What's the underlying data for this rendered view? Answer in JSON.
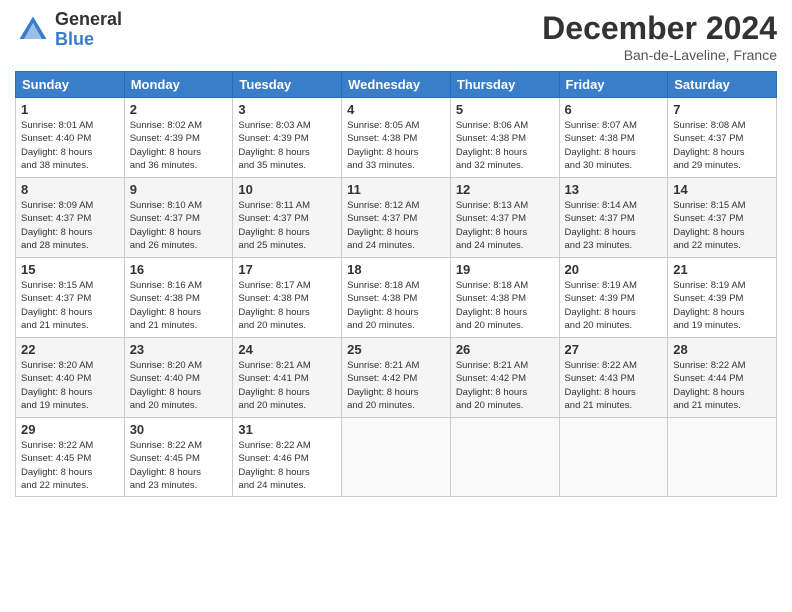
{
  "header": {
    "logo_general": "General",
    "logo_blue": "Blue",
    "month_title": "December 2024",
    "location": "Ban-de-Laveline, France"
  },
  "days_of_week": [
    "Sunday",
    "Monday",
    "Tuesday",
    "Wednesday",
    "Thursday",
    "Friday",
    "Saturday"
  ],
  "weeks": [
    [
      {
        "day": "1",
        "info": "Sunrise: 8:01 AM\nSunset: 4:40 PM\nDaylight: 8 hours\nand 38 minutes."
      },
      {
        "day": "2",
        "info": "Sunrise: 8:02 AM\nSunset: 4:39 PM\nDaylight: 8 hours\nand 36 minutes."
      },
      {
        "day": "3",
        "info": "Sunrise: 8:03 AM\nSunset: 4:39 PM\nDaylight: 8 hours\nand 35 minutes."
      },
      {
        "day": "4",
        "info": "Sunrise: 8:05 AM\nSunset: 4:38 PM\nDaylight: 8 hours\nand 33 minutes."
      },
      {
        "day": "5",
        "info": "Sunrise: 8:06 AM\nSunset: 4:38 PM\nDaylight: 8 hours\nand 32 minutes."
      },
      {
        "day": "6",
        "info": "Sunrise: 8:07 AM\nSunset: 4:38 PM\nDaylight: 8 hours\nand 30 minutes."
      },
      {
        "day": "7",
        "info": "Sunrise: 8:08 AM\nSunset: 4:37 PM\nDaylight: 8 hours\nand 29 minutes."
      }
    ],
    [
      {
        "day": "8",
        "info": "Sunrise: 8:09 AM\nSunset: 4:37 PM\nDaylight: 8 hours\nand 28 minutes."
      },
      {
        "day": "9",
        "info": "Sunrise: 8:10 AM\nSunset: 4:37 PM\nDaylight: 8 hours\nand 26 minutes."
      },
      {
        "day": "10",
        "info": "Sunrise: 8:11 AM\nSunset: 4:37 PM\nDaylight: 8 hours\nand 25 minutes."
      },
      {
        "day": "11",
        "info": "Sunrise: 8:12 AM\nSunset: 4:37 PM\nDaylight: 8 hours\nand 24 minutes."
      },
      {
        "day": "12",
        "info": "Sunrise: 8:13 AM\nSunset: 4:37 PM\nDaylight: 8 hours\nand 24 minutes."
      },
      {
        "day": "13",
        "info": "Sunrise: 8:14 AM\nSunset: 4:37 PM\nDaylight: 8 hours\nand 23 minutes."
      },
      {
        "day": "14",
        "info": "Sunrise: 8:15 AM\nSunset: 4:37 PM\nDaylight: 8 hours\nand 22 minutes."
      }
    ],
    [
      {
        "day": "15",
        "info": "Sunrise: 8:15 AM\nSunset: 4:37 PM\nDaylight: 8 hours\nand 21 minutes."
      },
      {
        "day": "16",
        "info": "Sunrise: 8:16 AM\nSunset: 4:38 PM\nDaylight: 8 hours\nand 21 minutes."
      },
      {
        "day": "17",
        "info": "Sunrise: 8:17 AM\nSunset: 4:38 PM\nDaylight: 8 hours\nand 20 minutes."
      },
      {
        "day": "18",
        "info": "Sunrise: 8:18 AM\nSunset: 4:38 PM\nDaylight: 8 hours\nand 20 minutes."
      },
      {
        "day": "19",
        "info": "Sunrise: 8:18 AM\nSunset: 4:38 PM\nDaylight: 8 hours\nand 20 minutes."
      },
      {
        "day": "20",
        "info": "Sunrise: 8:19 AM\nSunset: 4:39 PM\nDaylight: 8 hours\nand 20 minutes."
      },
      {
        "day": "21",
        "info": "Sunrise: 8:19 AM\nSunset: 4:39 PM\nDaylight: 8 hours\nand 19 minutes."
      }
    ],
    [
      {
        "day": "22",
        "info": "Sunrise: 8:20 AM\nSunset: 4:40 PM\nDaylight: 8 hours\nand 19 minutes."
      },
      {
        "day": "23",
        "info": "Sunrise: 8:20 AM\nSunset: 4:40 PM\nDaylight: 8 hours\nand 20 minutes."
      },
      {
        "day": "24",
        "info": "Sunrise: 8:21 AM\nSunset: 4:41 PM\nDaylight: 8 hours\nand 20 minutes."
      },
      {
        "day": "25",
        "info": "Sunrise: 8:21 AM\nSunset: 4:42 PM\nDaylight: 8 hours\nand 20 minutes."
      },
      {
        "day": "26",
        "info": "Sunrise: 8:21 AM\nSunset: 4:42 PM\nDaylight: 8 hours\nand 20 minutes."
      },
      {
        "day": "27",
        "info": "Sunrise: 8:22 AM\nSunset: 4:43 PM\nDaylight: 8 hours\nand 21 minutes."
      },
      {
        "day": "28",
        "info": "Sunrise: 8:22 AM\nSunset: 4:44 PM\nDaylight: 8 hours\nand 21 minutes."
      }
    ],
    [
      {
        "day": "29",
        "info": "Sunrise: 8:22 AM\nSunset: 4:45 PM\nDaylight: 8 hours\nand 22 minutes."
      },
      {
        "day": "30",
        "info": "Sunrise: 8:22 AM\nSunset: 4:45 PM\nDaylight: 8 hours\nand 23 minutes."
      },
      {
        "day": "31",
        "info": "Sunrise: 8:22 AM\nSunset: 4:46 PM\nDaylight: 8 hours\nand 24 minutes."
      },
      {
        "day": "",
        "info": ""
      },
      {
        "day": "",
        "info": ""
      },
      {
        "day": "",
        "info": ""
      },
      {
        "day": "",
        "info": ""
      }
    ]
  ]
}
